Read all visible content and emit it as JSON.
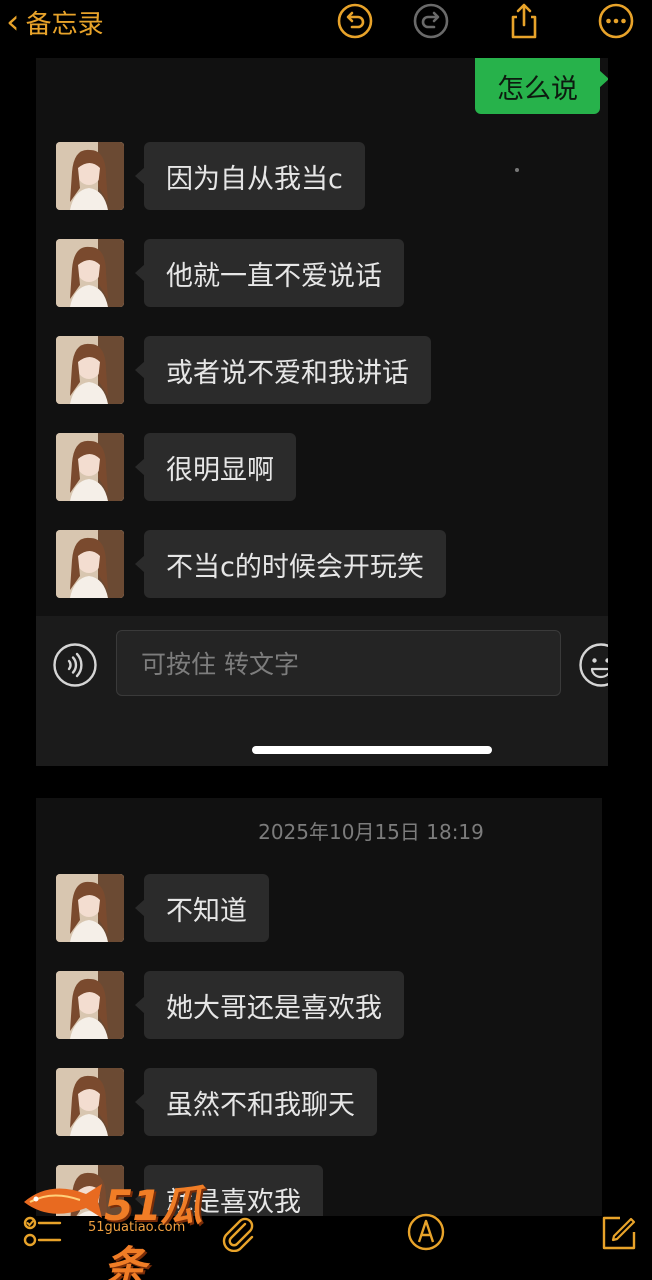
{
  "notes_app": {
    "back_label": "备忘录",
    "accent_color": "#e8a32a",
    "toolbar_icons": [
      "undo-icon",
      "redo-icon",
      "share-icon",
      "more-icon"
    ],
    "bottom_icons": [
      "checklist-icon",
      "paperclip-icon",
      "markup-icon",
      "compose-icon"
    ]
  },
  "screenshot1": {
    "my_message": "怎么说",
    "messages": [
      "因为自从我当c",
      "他就一直不爱说话",
      "或者说不爱和我讲话",
      "很明显啊",
      "不当c的时候会开玩笑"
    ],
    "input_placeholder": "可按住 转文字"
  },
  "screenshot2": {
    "timestamp": "2025年10月15日 18:19",
    "messages": [
      "不知道",
      "她大哥还是喜欢我",
      "虽然不和我聊天",
      "就是喜欢我"
    ]
  },
  "watermark": {
    "text": "51瓜条",
    "url": "51guatiao.com"
  }
}
